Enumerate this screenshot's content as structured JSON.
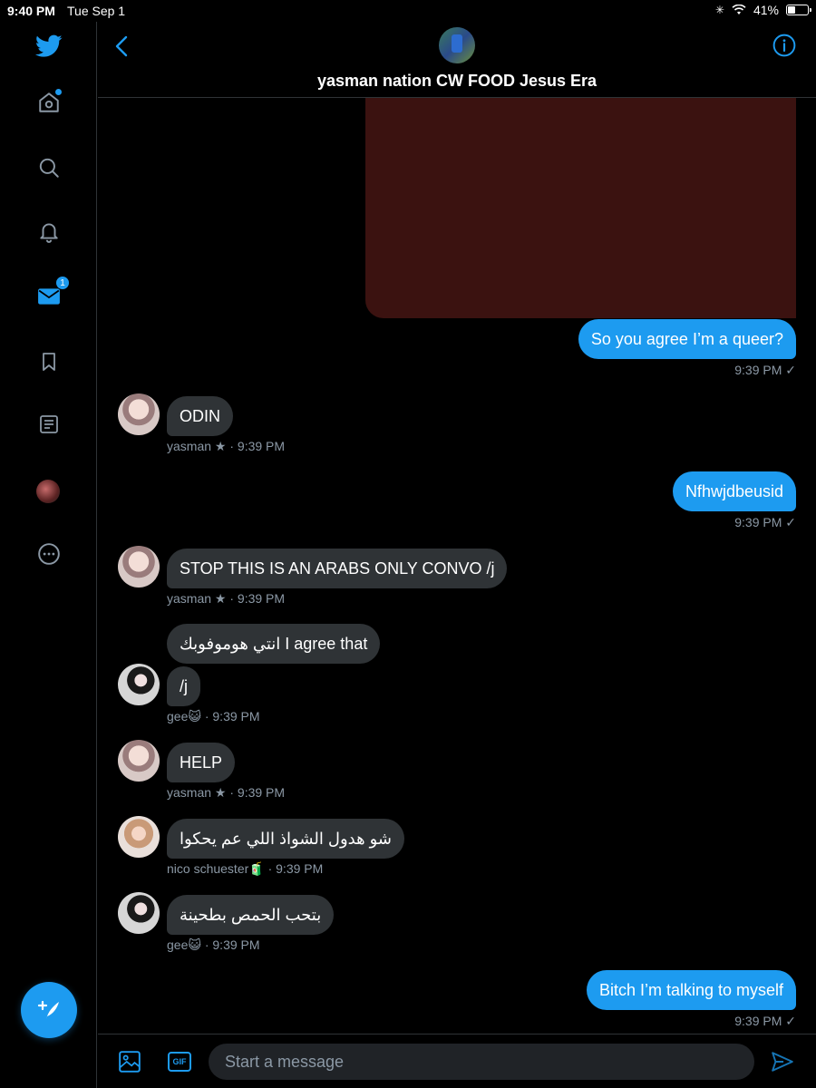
{
  "status_bar": {
    "time": "9:40 PM",
    "date": "Tue Sep 1",
    "battery": "41%",
    "battery_level": 0.41
  },
  "sidebar": {
    "items": [
      {
        "icon": "twitter-bird-icon"
      },
      {
        "icon": "home-icon",
        "has_dot": true
      },
      {
        "icon": "search-icon"
      },
      {
        "icon": "bell-icon"
      },
      {
        "icon": "mail-icon",
        "badge": "1"
      },
      {
        "icon": "bookmark-icon"
      },
      {
        "icon": "lists-icon"
      },
      {
        "icon": "profile-avatar"
      },
      {
        "icon": "more-icon"
      }
    ],
    "compose_icon": "compose-tweet-icon"
  },
  "header": {
    "title": "yasman nation CW FOOD Jesus Era"
  },
  "messages": [
    {
      "type": "sent",
      "text": "So you agree I’m a queer?",
      "time": "9:39 PM ✓"
    },
    {
      "type": "received",
      "sender": "yasman",
      "text": "ODIN",
      "meta": "yasman ★ · 9:39 PM"
    },
    {
      "type": "sent",
      "text": "Nfhwjdbeusid",
      "time": "9:39 PM ✓"
    },
    {
      "type": "received",
      "sender": "yasman",
      "text": "STOP THIS IS AN ARABS ONLY CONVO /j",
      "meta": "yasman ★ · 9:39 PM"
    },
    {
      "type": "received",
      "sender": "gee",
      "text": "انتي هوموفوبك I agree that",
      "meta": ""
    },
    {
      "type": "received",
      "sender": "gee",
      "text": "/j",
      "meta": "gee😺 · 9:39 PM"
    },
    {
      "type": "received",
      "sender": "yasman",
      "text": "HELP",
      "meta": "yasman ★ · 9:39 PM"
    },
    {
      "type": "received",
      "sender": "nico schuester",
      "text": "شو هدول الشواذ اللي عم يحكوا",
      "meta": "nico schuester🧃 · 9:39 PM"
    },
    {
      "type": "received",
      "sender": "gee",
      "text": "بتحب الحمص بطحينة",
      "meta": "gee😺 · 9:39 PM"
    },
    {
      "type": "sent",
      "text": "Bitch I’m talking to myself",
      "time": "9:39 PM ✓"
    }
  ],
  "composer": {
    "placeholder": "Start a message",
    "gif_label": "GIF"
  },
  "colors": {
    "accent": "#1d9bf0",
    "received_bubble": "#2f3336",
    "background": "#000000",
    "media": "#3b1210"
  }
}
